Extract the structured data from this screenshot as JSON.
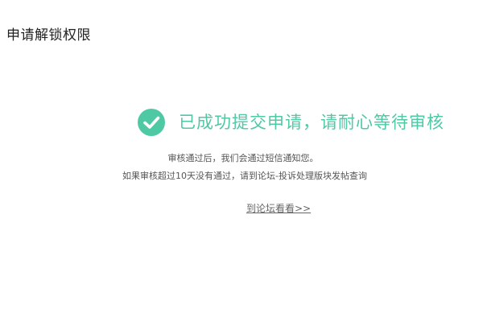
{
  "header": {
    "title": "申请解锁权限"
  },
  "result": {
    "icon": "check-circle-icon",
    "message": "已成功提交申请，请耐心等待审核",
    "accent_color": "#4fc9a4"
  },
  "info": {
    "line1": "审核通过后，我们会通过短信通知您。",
    "line2": "如果审核超过10天没有通过，请到论坛-投诉处理版块发帖查询"
  },
  "link": {
    "label": "到论坛看看>>"
  }
}
